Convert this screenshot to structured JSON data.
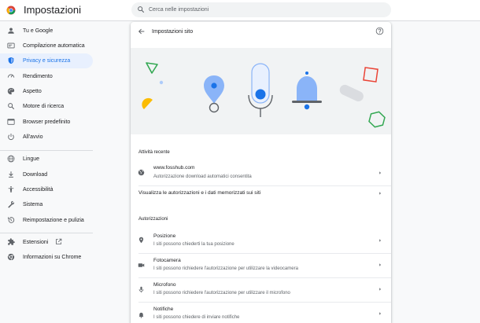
{
  "app": {
    "title": "Impostazioni",
    "logo_icon": "chrome-logo-icon"
  },
  "search": {
    "placeholder": "Cerca nelle impostazioni",
    "icon": "search-icon"
  },
  "sidebar": {
    "active_index": 2,
    "items": [
      {
        "label": "Tu e Google",
        "icon": "person-icon"
      },
      {
        "label": "Compilazione automatica",
        "icon": "autofill-icon"
      },
      {
        "label": "Privacy e sicurezza",
        "icon": "shield-icon"
      },
      {
        "label": "Rendimento",
        "icon": "speedometer-icon"
      },
      {
        "label": "Aspetto",
        "icon": "palette-icon"
      },
      {
        "label": "Motore di ricerca",
        "icon": "search-icon"
      },
      {
        "label": "Browser predefinito",
        "icon": "browser-icon"
      },
      {
        "label": "All'avvio",
        "icon": "power-icon"
      },
      {
        "label": "Lingue",
        "icon": "globe-icon"
      },
      {
        "label": "Download",
        "icon": "download-icon"
      },
      {
        "label": "Accessibilità",
        "icon": "accessibility-icon"
      },
      {
        "label": "Sistema",
        "icon": "wrench-icon"
      },
      {
        "label": "Reimpostazione e pulizia",
        "icon": "restore-icon"
      },
      {
        "label": "Estensioni",
        "icon": "puzzle-icon"
      },
      {
        "label": "Informazioni su Chrome",
        "icon": "chrome-logo-icon"
      }
    ]
  },
  "main": {
    "title": "Impostazioni sito",
    "recent": {
      "heading": "Attività recente",
      "site": "www.fosshub.com",
      "site_detail": "Autorizzazione download automatici consentita",
      "view_all": "Visualizza le autorizzazioni e i dati memorizzati sui siti"
    },
    "permissions": {
      "heading": "Autorizzazioni",
      "items": [
        {
          "title": "Posizione",
          "subtitle": "I siti possono chiederti la tua posizione",
          "icon": "location-pin-icon"
        },
        {
          "title": "Fotocamera",
          "subtitle": "I siti possono richiedere l'autorizzazione per utilizzare la videocamera",
          "icon": "camera-icon"
        },
        {
          "title": "Microfono",
          "subtitle": "I siti possono richiedere l'autorizzazione per utilizzare il microfono",
          "icon": "microphone-icon"
        },
        {
          "title": "Notifiche",
          "subtitle": "I siti possono chiedere di inviare notifiche",
          "icon": "bell-icon"
        }
      ]
    }
  },
  "colors": {
    "accent": "#1a73e8",
    "active_nav_bg": "#e8f0fe",
    "banner_bg": "#f1f3f4",
    "icon_grey": "#5f6368"
  }
}
